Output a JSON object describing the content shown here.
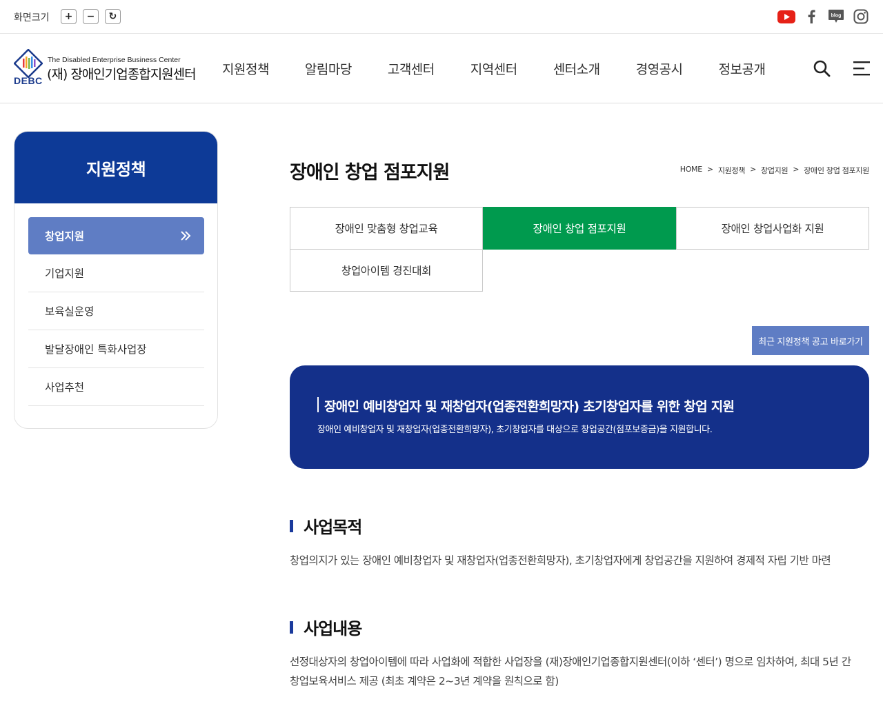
{
  "topbar": {
    "font_size_label": "화면크기",
    "plus": "+",
    "minus": "−",
    "reset": "↻",
    "social": [
      "youtube-icon",
      "facebook-icon",
      "blog-icon",
      "instagram-icon"
    ],
    "blog_text": "blog"
  },
  "header": {
    "logo_en": "The Disabled Enterprise Business Center",
    "logo_ko": "(재) 장애인기업종합지원센터",
    "logo_abbr": "DEBC",
    "nav": [
      "지원정책",
      "알림마당",
      "고객센터",
      "지역센터",
      "센터소개",
      "경영공시",
      "정보공개"
    ]
  },
  "sidebar": {
    "title": "지원정책",
    "items": [
      {
        "label": "창업지원",
        "active": true
      },
      {
        "label": "기업지원",
        "active": false
      },
      {
        "label": "보육실운영",
        "active": false
      },
      {
        "label": "발달장애인 특화사업장",
        "active": false
      },
      {
        "label": "사업추천",
        "active": false
      }
    ]
  },
  "page": {
    "title": "장애인 창업 점포지원",
    "breadcrumb": [
      "HOME",
      "지원정책",
      "창업지원",
      "장애인 창업 점포지원"
    ],
    "breadcrumb_sep": ">",
    "tabs": [
      {
        "label": "장애인 맞춤형 창업교육",
        "active": false
      },
      {
        "label": "장애인 창업 점포지원",
        "active": true
      },
      {
        "label": "장애인 창업사업화 지원",
        "active": false
      },
      {
        "label": "창업아이템 경진대회",
        "active": false
      }
    ],
    "notice_button": "최근 지원정책 공고 바로가기",
    "intro": {
      "title": "장애인 예비창업자 및 재창업자(업종전환희망자) 초기창업자를 위한 창업 지원",
      "desc": "장애인 예비창업자 및 재창업자(업종전환희망자), 초기창업자를 대상으로 창업공간(점포보증금)을 지원합니다."
    },
    "sections": [
      {
        "heading": "사업목적",
        "text": [
          "창업의지가 있는 장애인 예비창업자 및 재창업자(업종전환희망자), 초기창업자에게 창업공간을 지원하여 경제적 자립 기반 마련"
        ]
      },
      {
        "heading": "사업내용",
        "text": [
          "선정대상자의 창업아이템에 따라 사업화에 적합한 사업장을 (재)장애인기업종합지원센터(이하 ‘센터’) 명으로 임차하여, 최대 5년 간",
          "창업보육서비스 제공 (최초 계약은 2~3년 계약을 원칙으로 함)"
        ]
      }
    ]
  },
  "colors": {
    "primary_navy": "#0d3a97",
    "intro_navy": "#14308a",
    "active_green": "#009a4e",
    "sidebar_active": "#5f7dc4",
    "youtube_red": "#e62117"
  }
}
